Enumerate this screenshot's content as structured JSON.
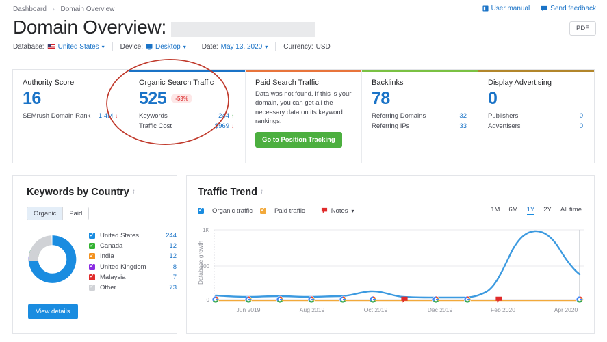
{
  "breadcrumb": {
    "root": "Dashboard",
    "separator": "›",
    "current": "Domain Overview"
  },
  "toplinks": {
    "user_manual": "User manual",
    "send_feedback": "Send feedback"
  },
  "header": {
    "title": "Domain Overview:",
    "pdf_button": "PDF"
  },
  "filters": {
    "database_label": "Database:",
    "database_value": "United States",
    "device_label": "Device:",
    "device_value": "Desktop",
    "date_label": "Date:",
    "date_value": "May 13, 2020",
    "currency_label": "Currency:",
    "currency_value": "USD"
  },
  "cards": [
    {
      "title": "Authority Score",
      "value": "16",
      "accent": "#ffffff",
      "rows": [
        {
          "label": "SEMrush Domain Rank",
          "value": "1.4M",
          "trend": "down"
        }
      ]
    },
    {
      "title": "Organic Search Traffic",
      "value": "525",
      "badge": "-53%",
      "accent": "#1a73c7",
      "rows": [
        {
          "label": "Keywords",
          "value": "244",
          "trend": "up"
        },
        {
          "label": "Traffic Cost",
          "value": "$969",
          "trend": "down"
        }
      ]
    },
    {
      "title": "Paid Search Traffic",
      "accent": "#e8743b",
      "message": "Data was not found. If this is your domain, you can get all the necessary data on its keyword rankings.",
      "button": "Go to Position Tracking"
    },
    {
      "title": "Backlinks",
      "value": "78",
      "accent": "#7ac143",
      "rows": [
        {
          "label": "Referring Domains",
          "value": "32"
        },
        {
          "label": "Referring IPs",
          "value": "33"
        }
      ]
    },
    {
      "title": "Display Advertising",
      "value": "0",
      "accent": "#b2862b",
      "rows": [
        {
          "label": "Publishers",
          "value": "0"
        },
        {
          "label": "Advertisers",
          "value": "0"
        }
      ]
    }
  ],
  "keywords_by_country": {
    "title": "Keywords by Country",
    "toggle": {
      "organic": "Organic",
      "paid": "Paid",
      "selected": "Organic"
    },
    "view_details": "View details",
    "chart_data": {
      "type": "pie",
      "title": "Keywords by Country",
      "categories": [
        "United States",
        "Canada",
        "India",
        "United Kingdom",
        "Malaysia",
        "Other"
      ],
      "values": [
        244,
        12,
        12,
        8,
        7,
        73
      ],
      "colors": [
        "#1a8ce0",
        "#34b233",
        "#f29120",
        "#8a2be2",
        "#e02b2b",
        "#d0d2d6"
      ],
      "legend": "right"
    }
  },
  "traffic_trend": {
    "title": "Traffic Trend",
    "series_toggles": [
      {
        "label": "Organic traffic",
        "color": "#1a8ce0",
        "checked": true
      },
      {
        "label": "Paid traffic",
        "color": "#f2a93b",
        "checked": true
      }
    ],
    "notes_label": "Notes",
    "ranges": [
      "1M",
      "6M",
      "1Y",
      "2Y",
      "All time"
    ],
    "selected_range": "1Y",
    "chart_data": {
      "type": "line",
      "title": "Traffic Trend",
      "ylabel": "Database growth",
      "xlabel": "",
      "ylim": [
        0,
        1000
      ],
      "yticks": [
        0,
        500,
        1000
      ],
      "ytick_labels": [
        "0",
        "500",
        "1K"
      ],
      "xticks": [
        "Jun 2019",
        "Aug 2019",
        "Oct 2019",
        "Dec 2019",
        "Feb 2020",
        "Apr 2020"
      ],
      "x": [
        "May 2019",
        "Jun 2019",
        "Jul 2019",
        "Aug 2019",
        "Sep 2019",
        "Oct 2019",
        "Nov 2019",
        "Dec 2019",
        "Jan 2020",
        "Feb 2020",
        "Mar 2020",
        "Apr 2020",
        "May 2020"
      ],
      "series": [
        {
          "name": "Organic traffic",
          "color": "#1a8ce0",
          "values": [
            60,
            45,
            48,
            52,
            110,
            60,
            40,
            35,
            35,
            90,
            880,
            1000,
            520
          ]
        },
        {
          "name": "Paid traffic",
          "color": "#f2a93b",
          "values": [
            0,
            0,
            0,
            0,
            0,
            0,
            0,
            0,
            0,
            0,
            0,
            0,
            0
          ]
        }
      ],
      "markers": [
        {
          "type": "google",
          "x": "May 2019"
        },
        {
          "type": "google",
          "x": "Jun 2019"
        },
        {
          "type": "google",
          "x": "Jul 2019"
        },
        {
          "type": "google",
          "x": "Aug 2019"
        },
        {
          "type": "google",
          "x": "Sep 2019"
        },
        {
          "type": "google",
          "x": "Oct 2019"
        },
        {
          "type": "note",
          "x": "Nov 2019"
        },
        {
          "type": "google",
          "x": "Dec 2019"
        },
        {
          "type": "google",
          "x": "Jan 2020"
        },
        {
          "type": "note",
          "x": "Feb 2020"
        },
        {
          "type": "google",
          "x": "May 2020"
        }
      ],
      "grid": true,
      "legend": "top-left"
    }
  },
  "annotation": {
    "shape": "ellipse",
    "color": "#c0392b",
    "target": "Organic Search Traffic card"
  }
}
